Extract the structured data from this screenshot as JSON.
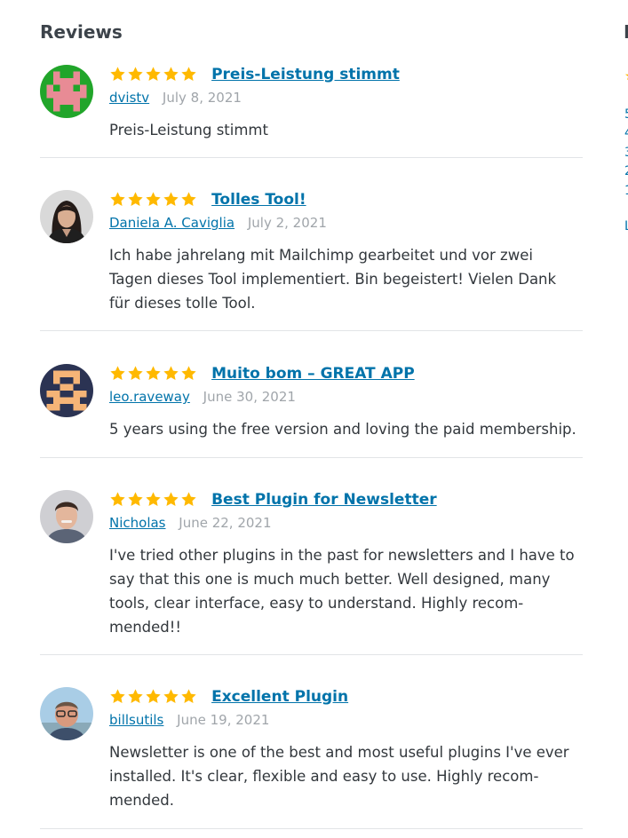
{
  "page": {
    "heading": "Reviews",
    "side_heading_fragment": "I"
  },
  "sidebar_fragment": {
    "star": "★",
    "links": [
      "5",
      "4",
      "3",
      "2",
      "1",
      "L"
    ]
  },
  "reviews": [
    {
      "title": "Preis-Leistung stimmt",
      "author": "dvistv",
      "date": "July 8, 2021",
      "rating": 5,
      "lines": [
        "Preis-Leistung stimmt"
      ],
      "avatar": "identicon-green"
    },
    {
      "title": "Tolles Tool!",
      "author": "Daniela A. Caviglia",
      "date": "July 2, 2021",
      "rating": 5,
      "lines": [
        "Ich habe jahrelang mit Mailchimp gearbeitet und vor zwei",
        "Tagen dieses Tool implementiert. Bin begeistert! Vielen Dank",
        "für dieses tolle Tool."
      ],
      "avatar": "photo-woman"
    },
    {
      "title": "Muito bom – GREAT APP",
      "author": "leo.raveway",
      "date": "June 30, 2021",
      "rating": 5,
      "lines": [
        "5 years using the free version and loving the paid membership."
      ],
      "avatar": "identicon-navy"
    },
    {
      "title": "Best Plugin for Newsletter",
      "author": "Nicholas",
      "date": "June 22, 2021",
      "rating": 5,
      "lines": [
        "I've tried other plugins in the past for newsletters and I have to",
        "say that this one is much much better. Well designed, many",
        "tools, clear interface, easy to understand. Highly recom-",
        "mended!!"
      ],
      "avatar": "photo-man"
    },
    {
      "title": "Excellent Plugin",
      "author": "billsutils",
      "date": "June 19, 2021",
      "rating": 5,
      "lines": [
        "Newsletter is one of the best and most useful plugins I've ever",
        "installed. It's clear, flexible and easy to use. Highly recom-",
        "mended."
      ],
      "avatar": "photo-man-glasses"
    }
  ],
  "colors": {
    "link": "#0073aa",
    "star": "#ffb900",
    "date": "#a0a5aa",
    "divider": "#e2e4e7"
  },
  "icons": {
    "star": "star-icon"
  }
}
